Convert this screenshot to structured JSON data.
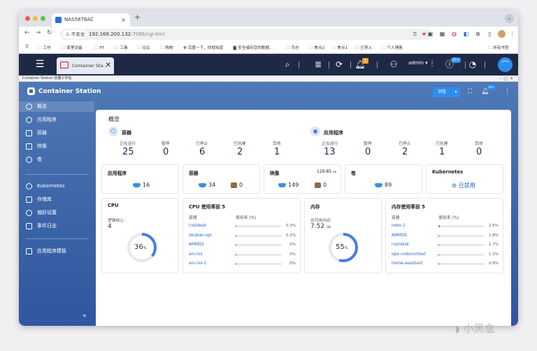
{
  "browser": {
    "tab_title": "NAS5878AC",
    "tab_close": "×",
    "new_tab": "+",
    "tab_menu": "⌄",
    "insecure_label": "不安全",
    "url_host": "192.168.200.132",
    "url_rest": ":7086/cgi-bin/",
    "bookmarks": [
      "工作",
      "家里设备",
      "PT",
      "工具",
      "论坛",
      "购物",
      "百度一下，你就知道",
      "安全储存您的数据...",
      "手办",
      "焦点2",
      "焦点1",
      "已导入",
      "个人博客"
    ],
    "all_bookmarks": "所有书签"
  },
  "qts": {
    "tab_label": "Container Sta...",
    "tab_close": "✕",
    "user": "admin ▾",
    "badge_notice": "1",
    "badge_update": "10+"
  },
  "window_title": "Container Station 容器工作站",
  "app": {
    "title": "Container Station",
    "browse_btn": "浏览",
    "browse_dd": "▾",
    "badge": "10+",
    "collapse": "«"
  },
  "sidebar": {
    "items": [
      "概览",
      "应用程序",
      "容器",
      "映像",
      "卷",
      "Kubernetes",
      "存储库",
      "偏好设置",
      "事件日志",
      "应用程序模板"
    ]
  },
  "overview": {
    "title": "概览",
    "containers": {
      "title": "容器",
      "labels": [
        "正在运行",
        "暂停",
        "已停止",
        "已创建",
        "其他"
      ],
      "values": [
        "25",
        "0",
        "6",
        "2",
        "1"
      ]
    },
    "apps": {
      "title": "应用程序",
      "labels": [
        "正在运行",
        "暂停",
        "已停止",
        "已创建",
        "其他"
      ],
      "values": [
        "13",
        "0",
        "2",
        "1",
        "0"
      ]
    }
  },
  "cards": {
    "apps": {
      "title": "应用程序",
      "v1": "16"
    },
    "containers": {
      "title": "容器",
      "v1": "34",
      "v2": "0"
    },
    "images": {
      "title": "映像",
      "size": "129.85",
      "unit": "GB",
      "v1": "149",
      "v2": "0"
    },
    "volumes": {
      "title": "卷",
      "v1": "89"
    },
    "k8s": {
      "title": "Kubernetes",
      "status": "已禁用"
    }
  },
  "cpu": {
    "title": "CPU",
    "cores_label": "逻辑核心",
    "cores": "4",
    "percent": 36,
    "percent_text": "36",
    "unit": "%"
  },
  "cpu_top": {
    "title": "CPU 使用率前 5",
    "col1": "容器",
    "col2": "使用率 (%)",
    "rows": [
      {
        "name": "rustdesk",
        "value": "0.3%",
        "frac": 0.003
      },
      {
        "name": "douban-api",
        "value": "0.2%",
        "frac": 0.002
      },
      {
        "name": "AMMDS",
        "value": "0%",
        "frac": 0
      },
      {
        "name": "ani-rss",
        "value": "0%",
        "frac": 0
      },
      {
        "name": "ani-rss-1",
        "value": "0%",
        "frac": 0
      }
    ]
  },
  "mem": {
    "title": "内存",
    "total_label": "总可用内存",
    "total": "7.52",
    "unit": "GB",
    "percent": 55,
    "percent_text": "55",
    "pct_unit": "%"
  },
  "mem_top": {
    "title": "内存使用率前 5",
    "col1": "容器",
    "col2": "使用率 (%)",
    "rows": [
      {
        "name": "neko-1",
        "value": "2.6%",
        "frac": 0.026
      },
      {
        "name": "AMMDS",
        "value": "1.8%",
        "frac": 0.018
      },
      {
        "name": "rustdesk",
        "value": "1.7%",
        "frac": 0.017
      },
      {
        "name": "ope-codecombat",
        "value": "1.1%",
        "frac": 0.011
      },
      {
        "name": "home-assistant",
        "value": "0.8%",
        "frac": 0.008
      }
    ]
  },
  "colors": {
    "accent": "#4a7de0",
    "header": "#1e2a45",
    "sidebar": "#3a63a6"
  },
  "watermark": "小黑盒"
}
